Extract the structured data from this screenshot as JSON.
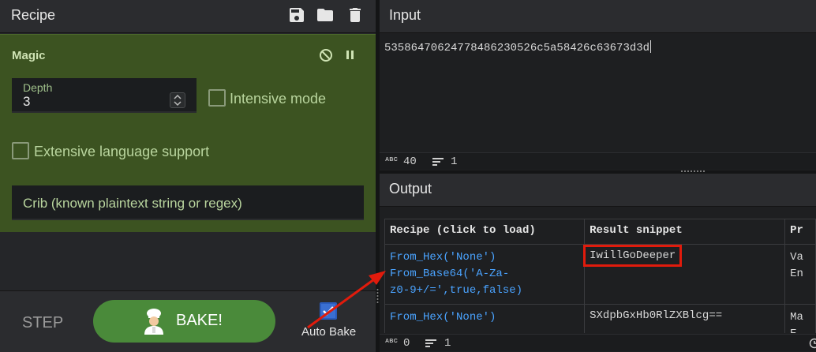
{
  "recipe": {
    "title": "Recipe",
    "icons": [
      "save-icon",
      "folder-icon",
      "trash-icon"
    ]
  },
  "operation": {
    "name": "Magic",
    "depth_label": "Depth",
    "depth_value": "3",
    "intensive_label": "Intensive mode",
    "extensive_label": "Extensive language support",
    "crib_placeholder": "Crib (known plaintext string or regex)"
  },
  "controls": {
    "step_label": "STEP",
    "bake_label": "BAKE!",
    "autobake_label": "Auto Bake",
    "autobake_checked": true
  },
  "input": {
    "title": "Input",
    "text": "5358647062477848623052 6c5a58426c63673d3d",
    "status": {
      "chars_icon": "ABC",
      "chars": "40",
      "lines": "1"
    }
  },
  "output": {
    "title": "Output",
    "table": {
      "headers": [
        "Recipe (click to load)",
        "Result snippet",
        "Pr"
      ],
      "rows": [
        {
          "recipe_lines": [
            "From_Hex('None')",
            "From_Base64('A-Za-",
            "z0-9+/=',true,false)"
          ],
          "snippet": "IwillGoDeeper",
          "props": [
            "Va",
            "En"
          ]
        },
        {
          "recipe_lines": [
            "From_Hex('None')"
          ],
          "snippet": "SXdpbGxHb0RlZXBlcg==",
          "props": [
            "Ma",
            "E"
          ]
        }
      ]
    },
    "status": {
      "chars_icon": "ABC",
      "chars": "0",
      "lines": "1"
    }
  },
  "colors": {
    "magic_bg": "#3c5321",
    "bake_button": "#4a8a3a",
    "link": "#4aa3ff",
    "highlight": "#e11b0c"
  }
}
